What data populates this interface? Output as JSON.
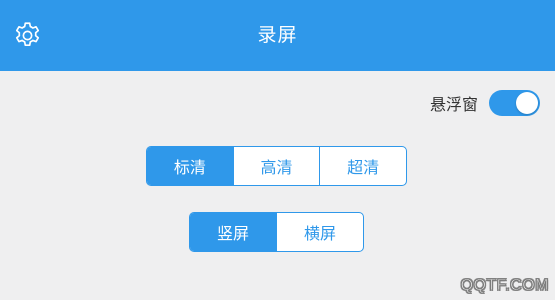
{
  "colors": {
    "primary": "#2f98ea",
    "background": "#efeff0",
    "label_text": "#333333"
  },
  "header": {
    "title": "录屏",
    "settings_icon": "gear-icon"
  },
  "float_window": {
    "label": "悬浮窗",
    "enabled": true
  },
  "quality": {
    "options": [
      "标清",
      "高清",
      "超清"
    ],
    "selected": "标清"
  },
  "orientation": {
    "options": [
      "竖屏",
      "横屏"
    ],
    "selected": "竖屏"
  },
  "watermark": "QQTF.COM"
}
